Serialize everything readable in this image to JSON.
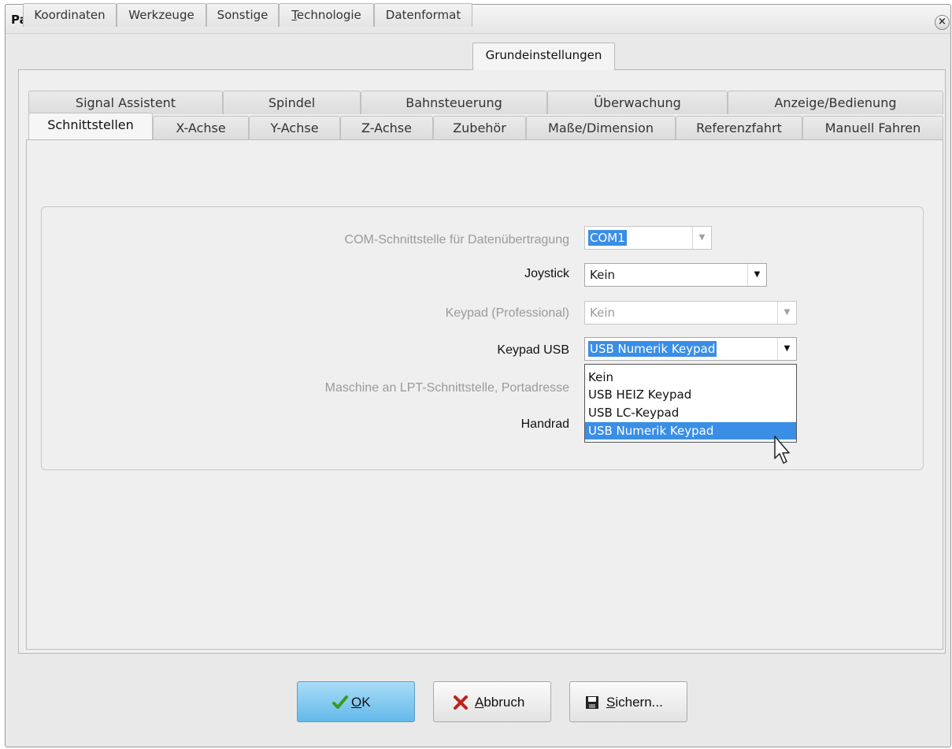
{
  "window": {
    "title": "Parameter"
  },
  "tabs_main": [
    {
      "label": "Koordinaten",
      "active": false
    },
    {
      "label": "Werkzeuge",
      "active": false
    },
    {
      "label": "Sonstige",
      "active": false
    },
    {
      "label": "Technologie",
      "active": false,
      "mnemonic": "T"
    },
    {
      "label": "Datenformat",
      "active": false
    },
    {
      "label": "Grundeinstellungen",
      "active": true
    }
  ],
  "tabs_sub_back": [
    {
      "label": "Signal Assistent"
    },
    {
      "label": "Spindel"
    },
    {
      "label": "Bahnsteuerung"
    },
    {
      "label": "Überwachung"
    },
    {
      "label": "Anzeige/Bedienung"
    }
  ],
  "tabs_sub_front": [
    {
      "label": "Schnittstellen",
      "active": true
    },
    {
      "label": "X-Achse"
    },
    {
      "label": "Y-Achse"
    },
    {
      "label": "Z-Achse"
    },
    {
      "label": "Zubehör"
    },
    {
      "label": "Maße/Dimension"
    },
    {
      "label": "Referenzfahrt"
    },
    {
      "label": "Manuell Fahren"
    }
  ],
  "fields": {
    "com": {
      "label": "COM-Schnittstelle für Datenübertragung",
      "value": "COM1",
      "enabled": false
    },
    "joystick": {
      "label": "Joystick",
      "value": "Kein",
      "enabled": true
    },
    "keypad_pro": {
      "label": "Keypad (Professional)",
      "value": "Kein",
      "enabled": false
    },
    "keypad_usb": {
      "label": "Keypad USB",
      "value": "USB Numerik Keypad",
      "enabled": true
    },
    "lpt": {
      "label": "Maschine an LPT-Schnittstelle, Portadresse",
      "enabled": false
    },
    "handrad": {
      "label": "Handrad",
      "enabled": true
    }
  },
  "dropdown_keypad_usb": {
    "options": [
      "Kein",
      "USB HEIZ Keypad",
      "USB LC-Keypad",
      "USB Numerik Keypad"
    ],
    "highlighted": "USB Numerik Keypad"
  },
  "buttons": {
    "ok": {
      "label_mn": "O",
      "label_rest": "K",
      "icon": "checkmark-icon"
    },
    "cancel": {
      "label_mn": "A",
      "label_rest": "bbruch",
      "icon": "cross-icon"
    },
    "save": {
      "label_mn": "S",
      "label_rest": "ichern...",
      "icon": "floppy-disk-icon"
    }
  },
  "colors": {
    "selection": "#3a8ee6",
    "ok_button": "#63b9ea",
    "cancel_icon": "#c0201a",
    "ok_icon": "#3a9a1a"
  }
}
